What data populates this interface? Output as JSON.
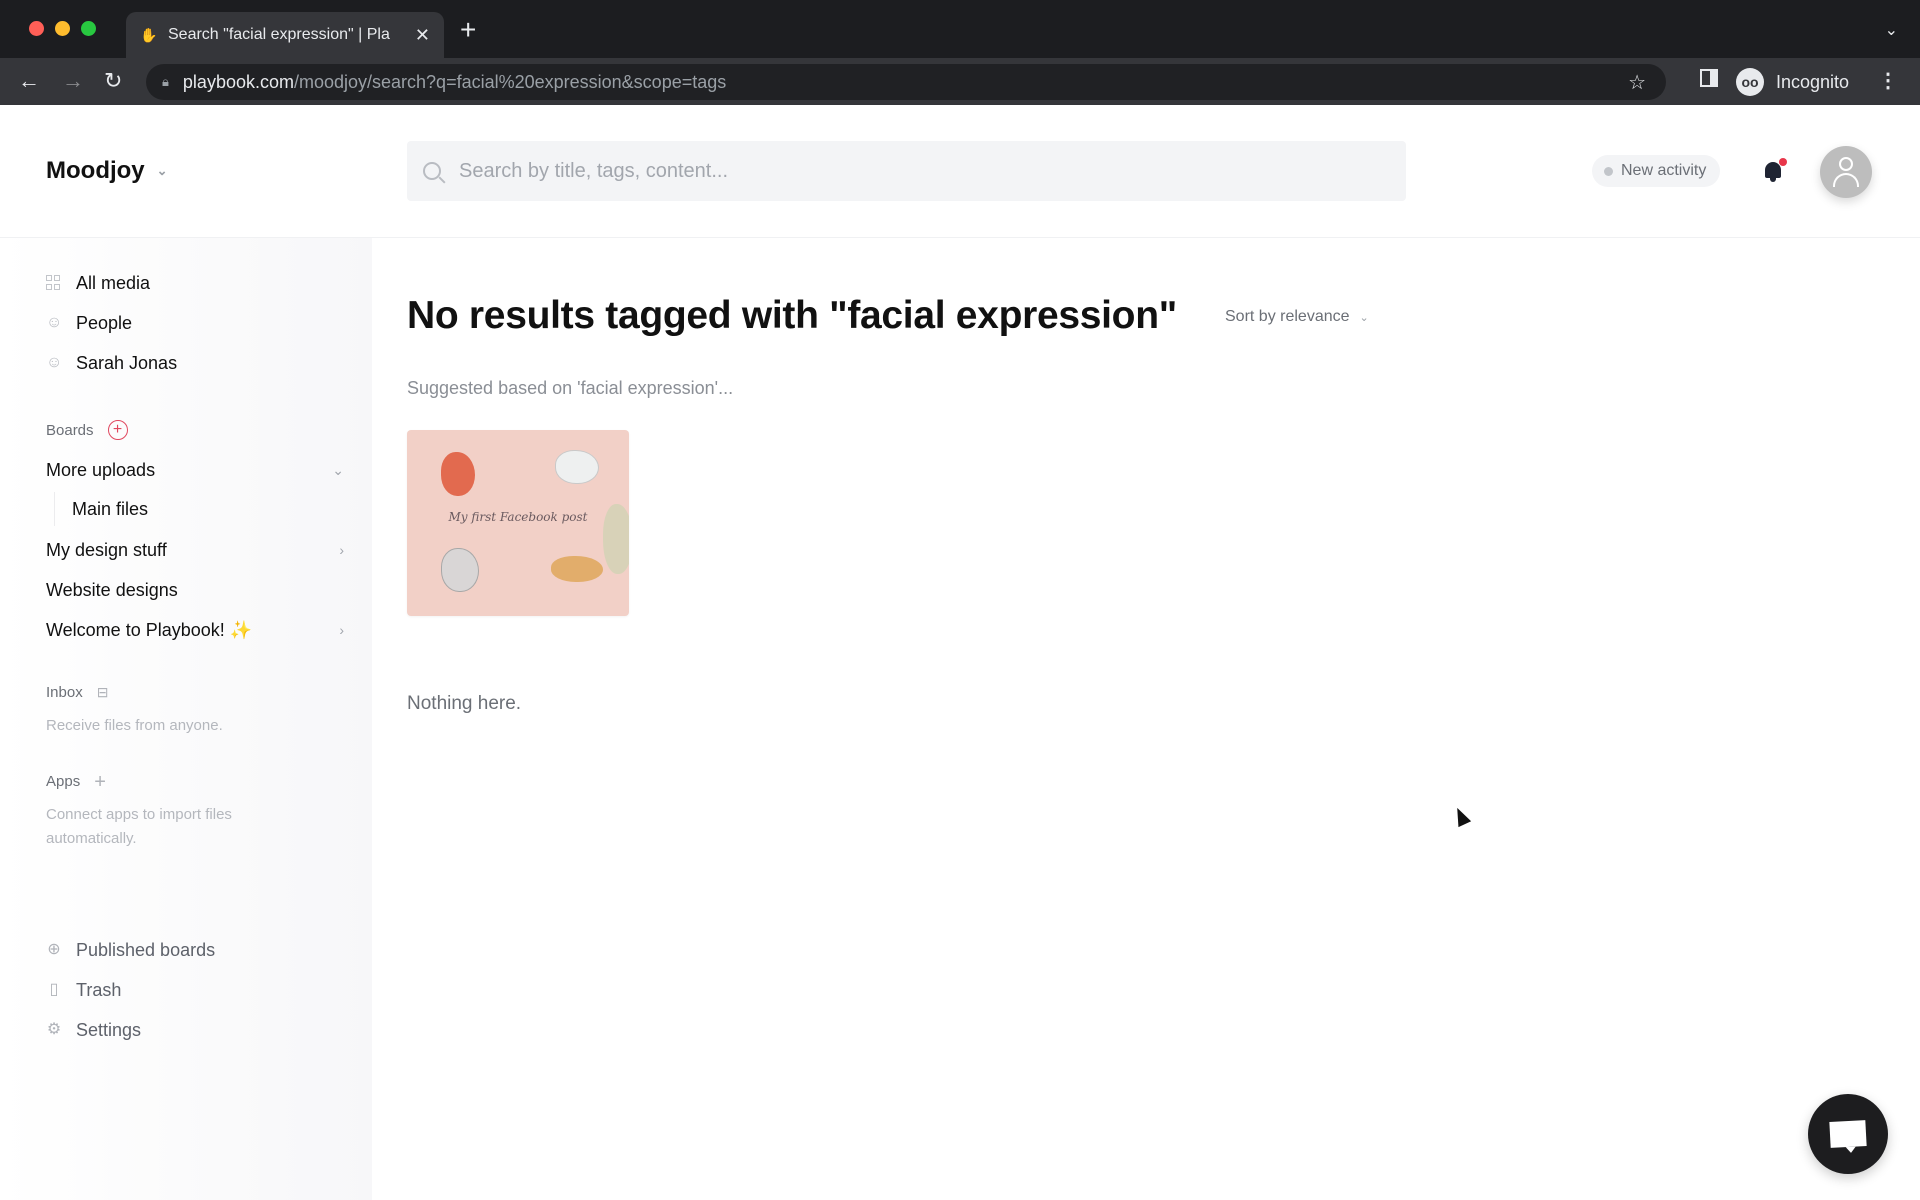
{
  "browser": {
    "tab_title": "Search \"facial expression\" | Pla",
    "new_tab_label": "+",
    "url_host": "playbook.com",
    "url_path": "/moodjoy/search?q=facial%20expression&scope=tags",
    "profile_label": "Incognito"
  },
  "header": {
    "workspace_name": "Moodjoy",
    "search_placeholder": "Search by title, tags, content...",
    "search_value": "",
    "activity_label": "New activity"
  },
  "sidebar": {
    "nav": [
      {
        "label": "All media",
        "icon": "grid-icon"
      },
      {
        "label": "People",
        "icon": "person-icon"
      },
      {
        "label": "Sarah Jonas",
        "icon": "smiley-icon"
      }
    ],
    "boards_label": "Boards",
    "boards": [
      {
        "label": "More uploads",
        "expanded": true,
        "children": [
          {
            "label": "Main files"
          }
        ]
      },
      {
        "label": "My design stuff",
        "expandable": true
      },
      {
        "label": "Website designs"
      },
      {
        "label": "Welcome to Playbook! ✨",
        "expandable": true
      }
    ],
    "inbox_label": "Inbox",
    "inbox_helper": "Receive files from anyone.",
    "apps_label": "Apps",
    "apps_helper": "Connect apps to import files automatically.",
    "footer": [
      {
        "label": "Published boards",
        "icon": "globe-icon"
      },
      {
        "label": "Trash",
        "icon": "trash-icon"
      },
      {
        "label": "Settings",
        "icon": "gear-icon"
      }
    ]
  },
  "main": {
    "title": "No results tagged with \"facial expression\"",
    "sort_label": "Sort by relevance",
    "suggested_label": "Suggested based on 'facial expression'...",
    "suggestions": [
      {
        "caption": "My first Facebook post"
      }
    ],
    "empty_label": "Nothing here."
  },
  "colors": {
    "accent": "#e0475f",
    "notification_badge": "#e8364a"
  }
}
